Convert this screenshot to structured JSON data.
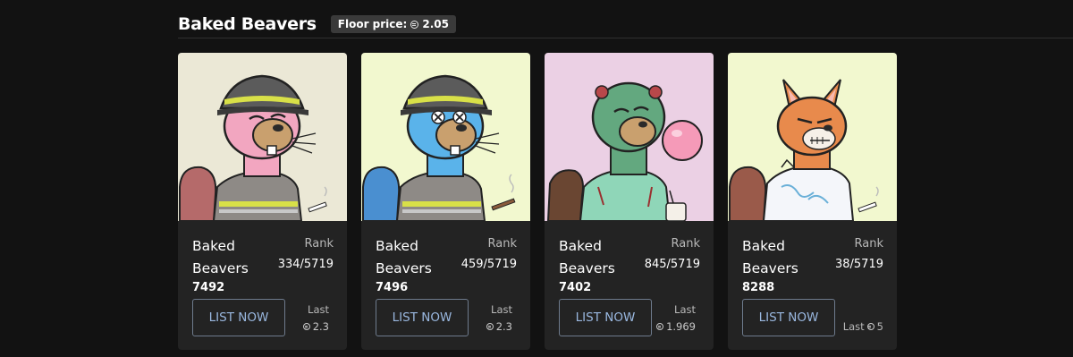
{
  "header": {
    "title": "Baked Beavers",
    "floor_price_label": "Floor price:",
    "floor_price_value": "2.05",
    "currency_icon": "sol-icon"
  },
  "colors": {
    "background": "#121212",
    "card": "#232323",
    "button_text": "#9ab8e0",
    "button_border": "#6e7b8d"
  },
  "cards": [
    {
      "name": "Baked Beavers",
      "id": "7492",
      "rank_label": "Rank",
      "rank": "334/5719",
      "button": "LIST NOW",
      "last_label": "Last",
      "last_value": "2.3",
      "bg_color": "#ebe8d6",
      "fur_color": "#f2a6c0",
      "outfit": "firefighter"
    },
    {
      "name": "Baked Beavers",
      "id": "7496",
      "rank_label": "Rank",
      "rank": "459/5719",
      "button": "LIST NOW",
      "last_label": "Last",
      "last_value": "2.3",
      "bg_color": "#f2f8cf",
      "fur_color": "#5ab3ea",
      "outfit": "firefighter"
    },
    {
      "name": "Baked Beavers",
      "id": "7402",
      "rank_label": "Rank",
      "rank": "845/5719",
      "button": "LIST NOW",
      "last_label": "Last",
      "last_value": "1.969",
      "bg_color": "#ebd0e4",
      "fur_color": "#63a87f",
      "outfit": "zombie"
    },
    {
      "name": "Baked Beavers",
      "id": "8288",
      "rank_label": "Rank",
      "rank": "38/5719",
      "button": "LIST NOW",
      "last_label": "Last",
      "last_value": "5",
      "bg_color": "#f2f8cf",
      "fur_color": "#e88a4c",
      "outfit": "hoodie"
    }
  ]
}
